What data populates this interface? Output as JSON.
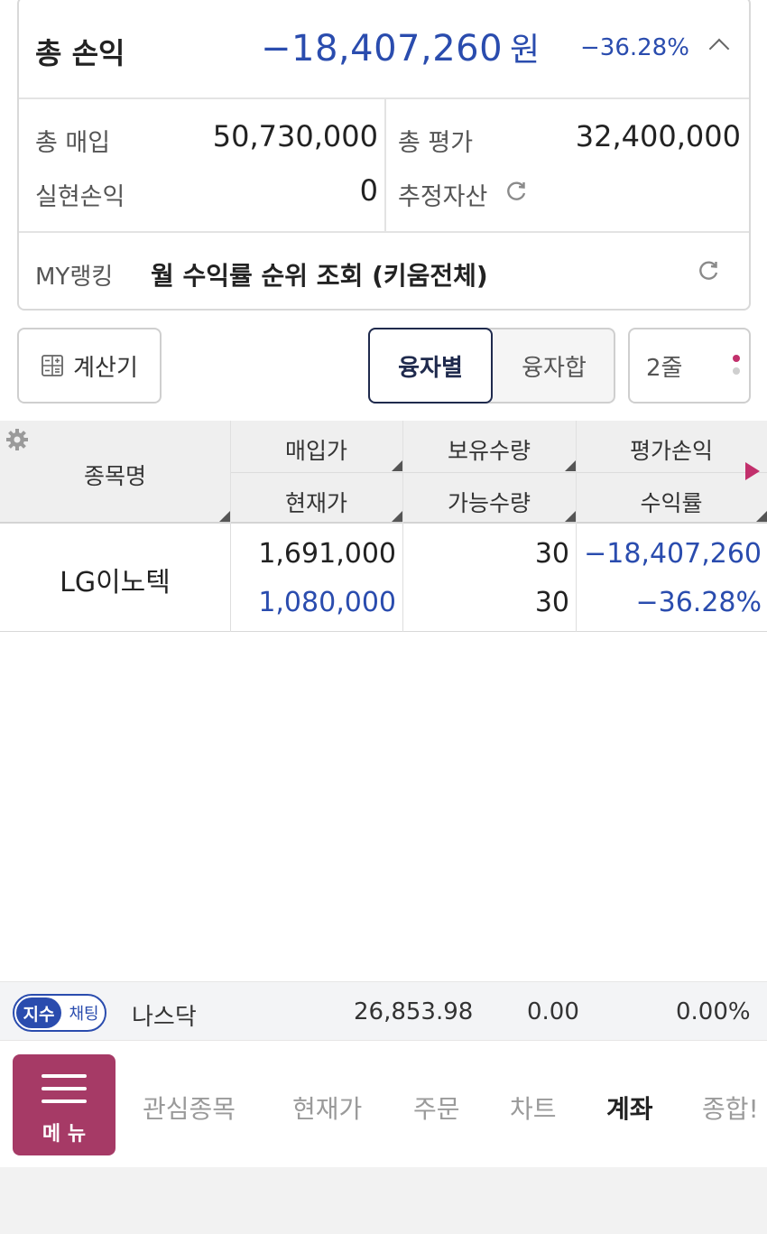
{
  "summary": {
    "total_pl_label": "총 손익",
    "total_pl_value": "−18,407,260",
    "total_pl_unit": "원",
    "total_pl_rate": "−36.28%",
    "total_buy_label": "총 매입",
    "total_buy_value": "50,730,000",
    "total_eval_label": "총 평가",
    "total_eval_value": "32,400,000",
    "realized_label": "실현손익",
    "realized_value": "0",
    "estimated_assets_label": "추정자산",
    "ranking_label": "MY랭킹",
    "ranking_text": "월 수익률 순위 조회 (키움전체)"
  },
  "toolbar": {
    "calculator_label": "계산기",
    "segment_active": "융자별",
    "segment_inactive": "융자합",
    "lines_label": "2줄"
  },
  "table": {
    "headers": {
      "name": "종목명",
      "buy_price": "매입가",
      "current_price": "현재가",
      "holding_qty": "보유수량",
      "available_qty": "가능수량",
      "eval_pl": "평가손익",
      "return_rate": "수익률"
    },
    "rows": [
      {
        "name": "LG이노텍",
        "buy_price": "1,691,000",
        "current_price": "1,080,000",
        "holding_qty": "30",
        "available_qty": "30",
        "eval_pl": "−18,407,260",
        "return_rate": "−36.28%"
      }
    ]
  },
  "ticker": {
    "pill_index": "지수",
    "pill_chat": "채팅",
    "name": "나스닥",
    "value": "26,853.98",
    "change": "0.00",
    "change_rate": "0.00%"
  },
  "nav": {
    "menu_label": "메 뉴",
    "items": [
      "관심종목",
      "현재가",
      "주문",
      "차트",
      "계좌",
      "종합!"
    ]
  },
  "colors": {
    "down_blue": "#2a4cae",
    "menu_accent": "#a63a66",
    "active_segment_border": "#1f2a4d"
  }
}
